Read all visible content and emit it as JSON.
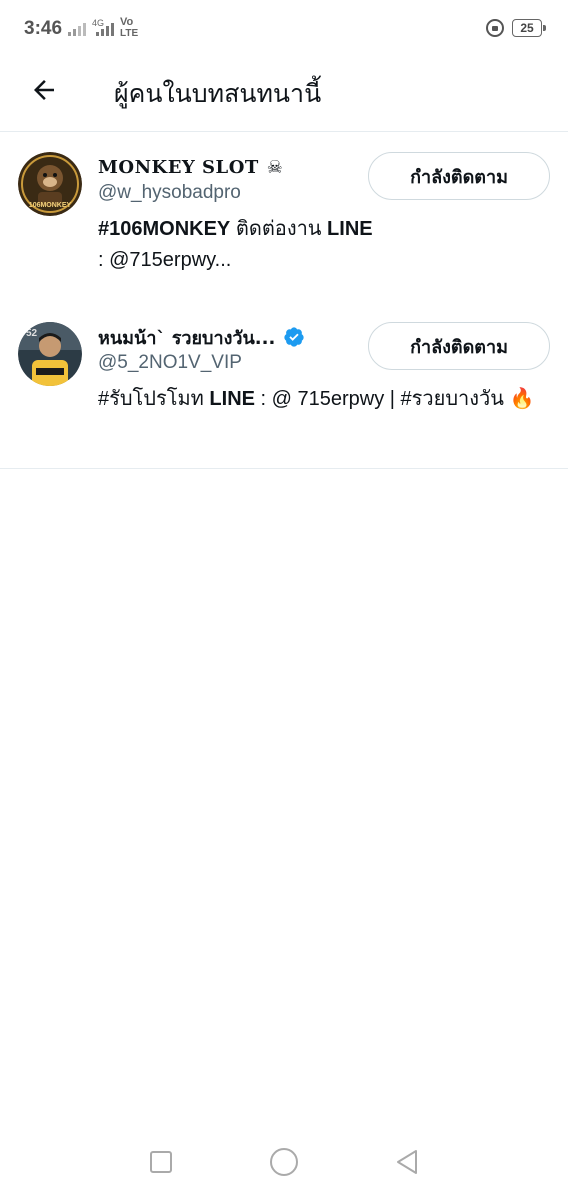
{
  "status": {
    "time": "3:46",
    "net_small": "4G",
    "volte": "Vo",
    "volte2": "LTE",
    "battery": "25"
  },
  "header": {
    "title": "ผู้คนในบทสนทนานี้",
    "back_icon": "arrow-left-icon"
  },
  "users": [
    {
      "name": "MONKEY SLOT",
      "name_emoji": "☠",
      "handle": "@w_hysobadpro",
      "bio_tag": "#106MONKEY",
      "bio_mid": " ติดต่องาน ",
      "bio_line": "LINE",
      "bio_rest": " : @715erpwy...",
      "follow_label": "กำลังติดตาม",
      "avatar_text": "106MONKEY"
    },
    {
      "name": "หนมน้า` รวยบางวัน...",
      "verified": true,
      "handle": "@5_2NO1V_VIP",
      "bio_tag": "#รับโปรโมท",
      "bio_mid": " ",
      "bio_line": "LINE",
      "bio_rest": " : @ 715erpwy |  #รวยบางวัน",
      "bio_emoji": "🔥",
      "follow_label": "กำลังติดตาม",
      "avatar_text": "52"
    }
  ],
  "nav": {
    "recents_icon": "square-icon",
    "home_icon": "circle-icon",
    "back_icon": "triangle-back-icon"
  },
  "colors": {
    "text": "#0f1419",
    "secondary": "#536471",
    "divider": "#e6ecf0",
    "verified": "#1d9bf0",
    "button_border": "#cfd9de"
  }
}
